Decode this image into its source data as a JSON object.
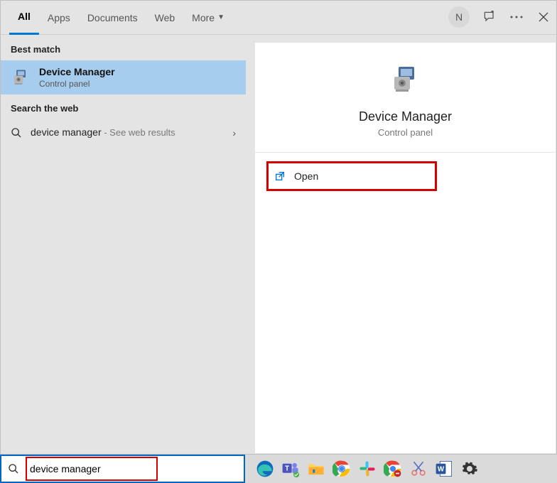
{
  "tabs": {
    "all": "All",
    "apps": "Apps",
    "documents": "Documents",
    "web": "Web",
    "more": "More"
  },
  "header": {
    "avatar_initial": "N"
  },
  "sections": {
    "best_match": "Best match",
    "search_web": "Search the web"
  },
  "best_match": {
    "title": "Device Manager",
    "subtitle": "Control panel"
  },
  "web_result": {
    "query": "device manager",
    "hint": " - See web results"
  },
  "preview": {
    "title": "Device Manager",
    "subtitle": "Control panel",
    "open_label": "Open"
  },
  "search": {
    "value": "device manager"
  }
}
